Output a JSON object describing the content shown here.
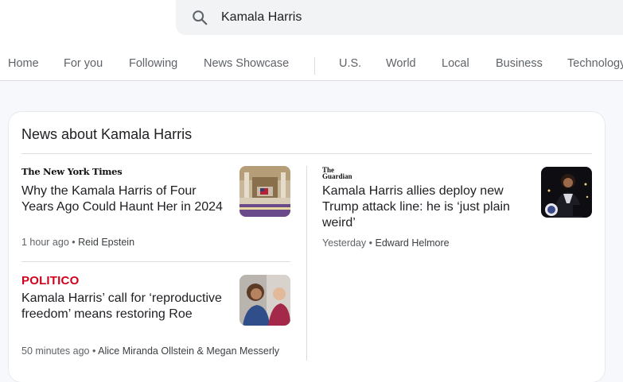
{
  "search": {
    "query": "Kamala Harris"
  },
  "nav": {
    "tabs": [
      "Home",
      "For you",
      "Following",
      "News Showcase",
      "U.S.",
      "World",
      "Local",
      "Business",
      "Technology"
    ]
  },
  "section": {
    "title": "News about Kamala Harris"
  },
  "articles": [
    {
      "source": "The New York Times",
      "headline": "Why the Kamala Harris of Four Years Ago Could Haunt Her in 2024",
      "time": "1 hour ago",
      "author": "Reid Epstein"
    },
    {
      "source": "POLITICO",
      "headline": "Kamala Harris’ call for ‘reproductive freedom’ means restoring Roe",
      "time": "50 minutes ago",
      "author": "Alice Miranda Ollstein & Megan Messerly"
    },
    {
      "source": "The Guardian",
      "headline": "Kamala Harris allies deploy new Trump attack line: he is ‘just plain weird’",
      "time": "Yesterday",
      "author": "Edward Helmore"
    }
  ],
  "meta_separator": "•",
  "icons": {
    "search": "search-icon"
  },
  "colors": {
    "politico": "#d0011b",
    "background": "#f6f8fc"
  }
}
